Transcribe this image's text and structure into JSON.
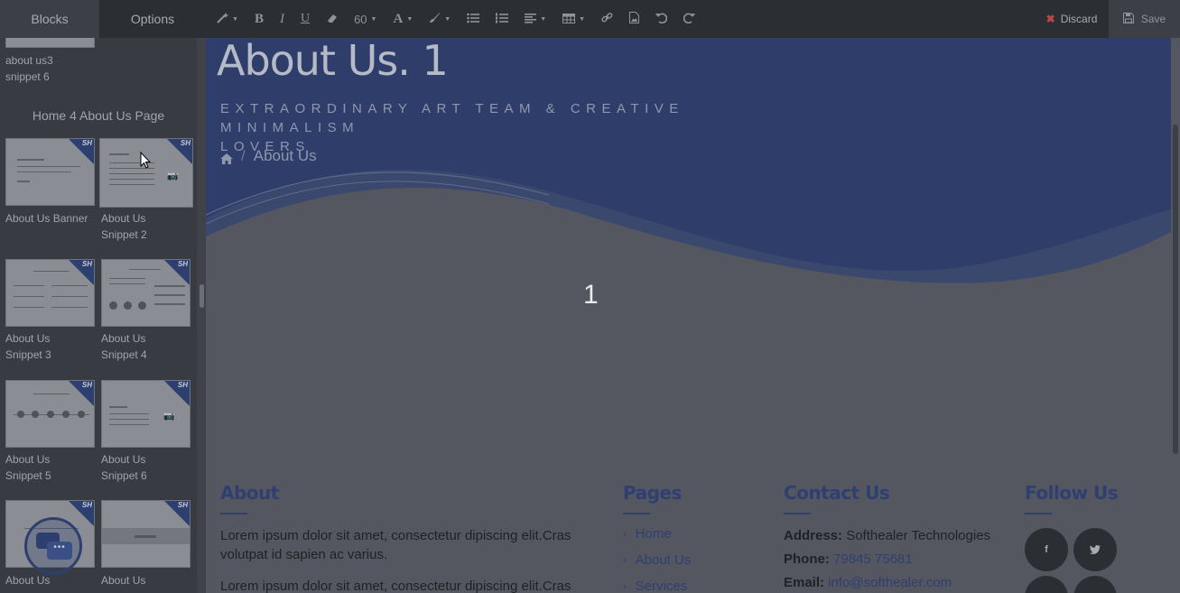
{
  "toolbar": {
    "tab_blocks": "Blocks",
    "tab_options": "Options",
    "font_size": "60",
    "bold": "B",
    "italic": "I",
    "underline": "U",
    "font_color": "A",
    "discard_label": "Discard",
    "save_label": "Save"
  },
  "sidebar": {
    "top_caption_line1": "about us3",
    "top_caption_line2": "snippet 6",
    "group_title": "Home 4 About Us Page",
    "badge": "SH",
    "snippets": [
      {
        "line1": "About Us Banner",
        "line2": ""
      },
      {
        "line1": "About Us",
        "line2": "Snippet 2"
      },
      {
        "line1": "About Us",
        "line2": "Snippet 3"
      },
      {
        "line1": "About Us",
        "line2": "Snippet 4"
      },
      {
        "line1": "About Us",
        "line2": "Snippet 5"
      },
      {
        "line1": "About Us",
        "line2": "Snippet 6"
      },
      {
        "line1": "About Us",
        "line2": ""
      },
      {
        "line1": "About Us",
        "line2": ""
      }
    ]
  },
  "hero": {
    "title": "About Us. 1",
    "subtitle_line1": "EXTRAORDINARY ART TEAM & CREATIVE MINIMALISM",
    "subtitle_line2": "LOVERS",
    "breadcrumb_sep": "/",
    "breadcrumb_current": "About Us",
    "number": "1"
  },
  "footer": {
    "about": {
      "title": "About",
      "p1": "Lorem ipsum dolor sit amet, consectetur dipiscing elit.Cras volutpat id sapien ac varius.",
      "p2": "Lorem ipsum dolor sit amet, consectetur dipiscing elit.Cras"
    },
    "pages": {
      "title": "Pages",
      "links": [
        "Home",
        "About Us",
        "Services"
      ]
    },
    "contact": {
      "title": "Contact Us",
      "address_label": "Address:",
      "address_value": "Softhealer Technologies",
      "phone_label": "Phone:",
      "phone_value": "79845 75681",
      "email_label": "Email:",
      "email_value": "info@softhealer.com"
    },
    "follow": {
      "title": "Follow Us",
      "facebook": "f",
      "twitter": "t"
    }
  },
  "colors": {
    "hero_bg": "#2f3d6b",
    "accent": "#2f3f72",
    "toolbar_bg": "#2b2e33",
    "discard_icon": "#b94a48"
  }
}
